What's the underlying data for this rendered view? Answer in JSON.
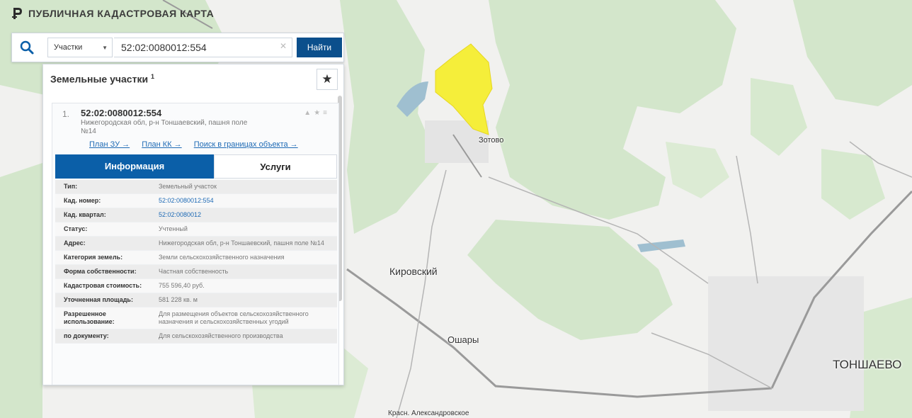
{
  "app": {
    "title": "ПУБЛИЧНАЯ КАДАСТРОВАЯ КАРТА"
  },
  "search": {
    "type_select": "Участки",
    "value": "52:02:0080012:554",
    "find_button": "Найти"
  },
  "panel": {
    "heading": "Земельные участки",
    "heading_count": "1",
    "result": {
      "number": "1.",
      "cadastral": "52:02:0080012:554",
      "address_line1": "Нижегородская обл, р-н Тоншаевский, пашня поле",
      "address_line2": "№14",
      "links": [
        "План ЗУ →",
        "План КК →",
        "Поиск в границах объекта →"
      ]
    },
    "tabs": [
      "Информация",
      "Услуги"
    ],
    "rows": [
      {
        "key": "Тип:",
        "value": "Земельный участок"
      },
      {
        "key": "Кад. номер:",
        "value": "52:02:0080012:554"
      },
      {
        "key": "Кад. квартал:",
        "value": "52:02:0080012"
      },
      {
        "key": "Статус:",
        "value": "Учтенный"
      },
      {
        "key": "Адрес:",
        "value": "Нижегородская обл, р-н Тоншаевский, пашня поле №14"
      },
      {
        "key": "Категория земель:",
        "value": "Земли сельскохозяйственного назначения"
      },
      {
        "key": "Форма собственности:",
        "value": "Частная собственность"
      },
      {
        "key": "Кадастровая стоимость:",
        "value": "755 596,40 руб."
      },
      {
        "key": "Уточненная площадь:",
        "value": "581 228 кв. м"
      },
      {
        "key": "Разрешенное использование:",
        "value": "Для размещения объектов сельскохозяйственного назначения и сельскохозяйственных угодий"
      },
      {
        "key": "по документу:",
        "value": "Для сельскохозяйственного производства"
      }
    ]
  },
  "map_labels": {
    "zotovo": "Зотово",
    "kirovsky": "Кировский",
    "oshary": "Ошары",
    "tonshaevo": "ТОНШАЕВО",
    "krasn": "Красн. Александровское"
  },
  "colors": {
    "parcel": "#f5ee3a",
    "forest": "#cfe3c6",
    "water": "#9fbfd0",
    "button": "#0b4f8c",
    "tab_active": "#0b5fa8"
  }
}
